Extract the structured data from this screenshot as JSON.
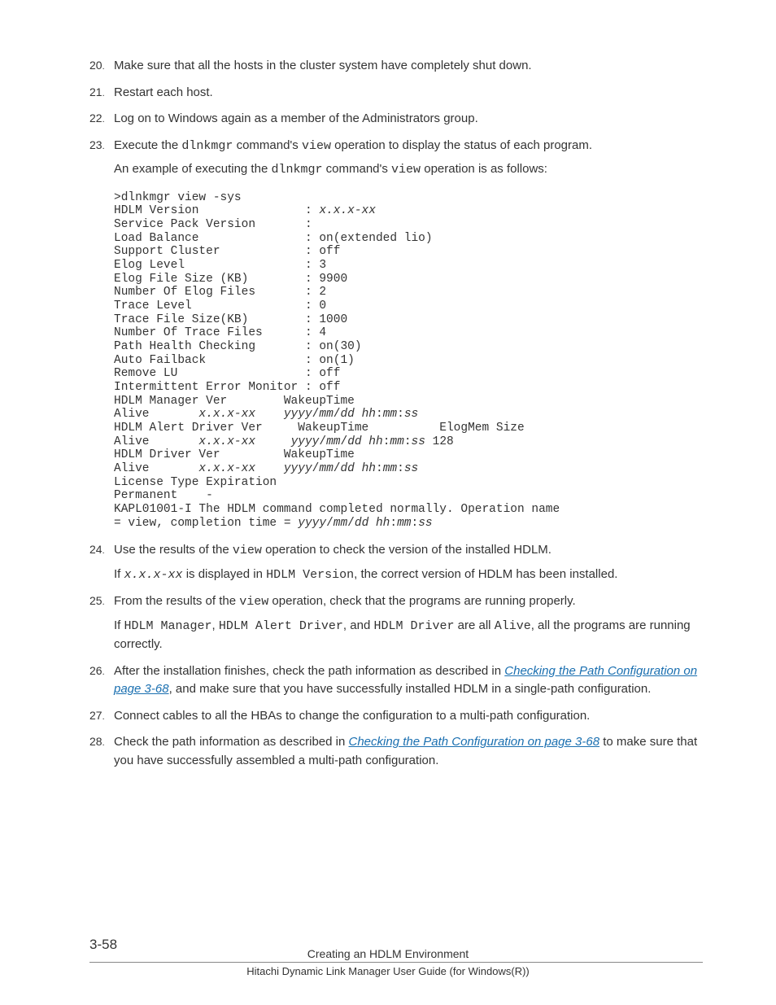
{
  "steps": {
    "20": {
      "num": "20",
      "text": "Make sure that all the hosts in the cluster system have completely shut down."
    },
    "21": {
      "num": "21",
      "text": "Restart each host."
    },
    "22": {
      "num": "22",
      "text": "Log on to Windows again as a member of the Administrators group."
    },
    "23": {
      "num": "23",
      "p1a": "Execute the ",
      "cmd1": "dlnkmgr",
      "p1b": " command's ",
      "cmd2": "view",
      "p1c": " operation to display the status of each program.",
      "p2a": "An example of executing the ",
      "cmd3": "dlnkmgr",
      "p2b": " command's ",
      "cmd4": "view",
      "p2c": " operation is as follows:"
    },
    "24": {
      "num": "24",
      "p1a": "Use the results of the ",
      "cmd1": "view",
      "p1b": " operation to check the version of the installed HDLM.",
      "p2a": "If ",
      "ver": "x.x.x-xx",
      "p2b": " is displayed in ",
      "cmd2": "HDLM Version",
      "p2c": ", the correct version of HDLM has been installed."
    },
    "25": {
      "num": "25",
      "p1a": "From the results of the ",
      "cmd1": "view",
      "p1b": " operation, check that the programs are running properly.",
      "p2a": "If ",
      "c1": "HDLM Manager",
      "sep1": ", ",
      "c2": "HDLM Alert Driver",
      "sep2": ", and ",
      "c3": "HDLM Driver",
      "p2b": " are all ",
      "c4": "Alive",
      "p2c": ", all the programs are running correctly."
    },
    "26": {
      "num": "26",
      "p1a": "After the installation finishes, check the path information as described in ",
      "link": "Checking the Path Configuration on page 3-68",
      "p1b": ", and make sure that you have successfully installed HDLM in a single-path configuration."
    },
    "27": {
      "num": "27",
      "text": "Connect cables to all the HBAs to change the configuration to a multi-path configuration."
    },
    "28": {
      "num": "28",
      "p1a": "Check the path information as described in ",
      "link": "Checking the Path Configuration on page 3-68",
      "p1b": " to make sure that you have successfully assembled a multi-path configuration."
    }
  },
  "code": {
    "l1": ">dlnkmgr view -sys",
    "l2a": "HDLM Version               : ",
    "l2v": "x.x.x-xx",
    "l3": "Service Pack Version       : ",
    "l4": "Load Balance               : on(extended lio)",
    "l5": "Support Cluster            : off",
    "l6": "Elog Level                 : 3",
    "l7": "Elog File Size (KB)        : 9900",
    "l8": "Number Of Elog Files       : 2",
    "l9": "Trace Level                : 0",
    "l10": "Trace File Size(KB)        : 1000",
    "l11": "Number Of Trace Files      : 4",
    "l12": "Path Health Checking       : on(30)",
    "l13": "Auto Failback              : on(1)",
    "l14": "Remove LU                  : off",
    "l15": "Intermittent Error Monitor : off",
    "l16": "HDLM Manager Ver        WakeupTime",
    "l17a": "Alive       ",
    "l17v": "x.x.x-xx",
    "l17b": "    ",
    "l17d": "yyyy",
    "l17e": "/",
    "l17f": "mm",
    "l17g": "/",
    "l17h": "dd hh",
    "l17i": ":",
    "l17j": "mm",
    "l17k": ":",
    "l17l": "ss",
    "l18": "HDLM Alert Driver Ver     WakeupTime          ElogMem Size",
    "l19a": "Alive       ",
    "l19v": "x.x.x-xx",
    "l19b": "     ",
    "l19d": "yyyy",
    "l19e": "/",
    "l19f": "mm",
    "l19g": "/",
    "l19h": "dd hh",
    "l19i": ":",
    "l19j": "mm",
    "l19k": ":",
    "l19l": "ss",
    "l19m": " 128",
    "l20": "HDLM Driver Ver         WakeupTime",
    "l21a": "Alive       ",
    "l21v": "x.x.x-xx",
    "l21b": "    ",
    "l21d": "yyyy",
    "l21e": "/",
    "l21f": "mm",
    "l21g": "/",
    "l21h": "dd hh",
    "l21i": ":",
    "l21j": "mm",
    "l21k": ":",
    "l21l": "ss",
    "l22": "License Type Expiration",
    "l23": "Permanent    -",
    "l24": "KAPL01001-I The HDLM command completed normally. Operation name ",
    "l25a": "= view, completion time = ",
    "l25d": "yyyy",
    "l25e": "/",
    "l25f": "mm",
    "l25g": "/",
    "l25h": "dd hh",
    "l25i": ":",
    "l25j": "mm",
    "l25k": ":",
    "l25l": "ss"
  },
  "footer": {
    "pagenum": "3-58",
    "chapter": "Creating an HDLM Environment",
    "sub": "Hitachi Dynamic Link Manager User Guide (for Windows(R))"
  }
}
